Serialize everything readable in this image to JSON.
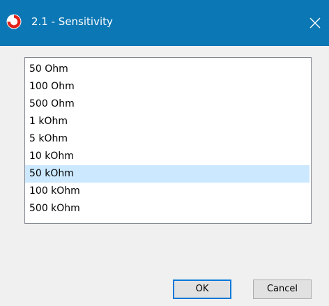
{
  "window": {
    "title": "2.1 - Sensitivity",
    "app_icon": "red-circle-app-icon",
    "close_icon": "close-icon",
    "title_bar_color": "#0b77b5"
  },
  "list": {
    "items": [
      {
        "label": "50 Ohm",
        "selected": false
      },
      {
        "label": "100 Ohm",
        "selected": false
      },
      {
        "label": "500 Ohm",
        "selected": false
      },
      {
        "label": "1 kOhm",
        "selected": false
      },
      {
        "label": "5 kOhm",
        "selected": false
      },
      {
        "label": "10 kOhm",
        "selected": false
      },
      {
        "label": "50 kOhm",
        "selected": true
      },
      {
        "label": "100 kOhm",
        "selected": false
      },
      {
        "label": "500 kOhm",
        "selected": false
      }
    ],
    "selection_color": "#cce8ff"
  },
  "buttons": {
    "ok_label": "OK",
    "cancel_label": "Cancel"
  }
}
